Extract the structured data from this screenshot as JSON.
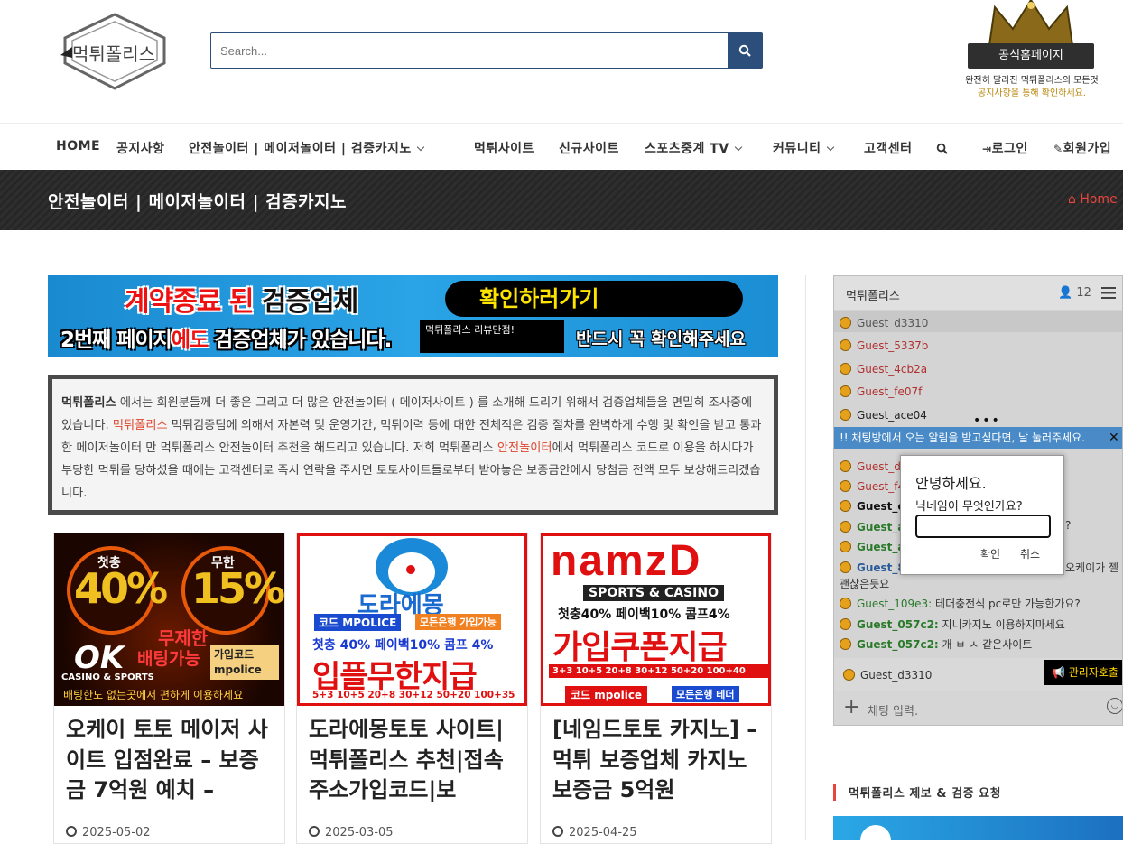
{
  "logo": {
    "text": "먹튀폴리스"
  },
  "search": {
    "placeholder": "Search..."
  },
  "crown_badge": {
    "label": "공식홈페이지",
    "line1": "완전히 달라진 먹튀폴리스의 모든것",
    "line2": "공지사항을 통해 확인하세요."
  },
  "nav": {
    "items": [
      "HOME",
      "공지사항",
      "안전놀이터 | 메이저놀이터 | 검증카지노",
      "먹튀사이트",
      "신규사이트",
      "스포츠중계 TV",
      "커뮤니티",
      "고객센터"
    ],
    "login": "로그인",
    "signup": "회원가입"
  },
  "page_title": "안전놀이터 | 메이저놀이터 | 검증카지노",
  "breadcrumb": {
    "home": "Home"
  },
  "banner": {
    "line1_red": "계약종료 된 ",
    "line1_black": "검증업체",
    "pill": "확인하러가기",
    "line2_white1": "2번째 페이지",
    "line2_red": "에도 ",
    "line2_white2": "검증업체",
    "line2_end": "가 있습니다.",
    "box": "먹튀폴리스 리뷰만점!",
    "line3": "반드시 꼭 확인해주세요"
  },
  "intro": {
    "p1_bold": "먹튀폴리스",
    "p1": " 에서는 회원분들께 더 좋은 그리고 더 많은 안전놀이터 ( 메이저사이트 ) 를 소개해 드리기 위해서 검증업체들을 면밀히 조사중에 있습니다. ",
    "p1_link": "먹튀폴리스",
    "p2": " 먹튀검증팀에 의해서 자본력 및 운영기간, 먹튀이력 등에 대한 전체적은 검증 절차를 완벽하게 수행 및 확인을 받고 통과한 메이저놀이터 만 먹튀폴리스 안전놀이터 추천을 해드리고 있습니다. 저희 먹튀폴리스 ",
    "p2_link": "안전놀이터",
    "p3": "에서 먹튀폴리스 코드로 이용을 하시다가 부당한 먹튀를 당하셨을 때에는 고객센터로 즉시 연락을 주시면 토토사이트들로부터 받아놓은 보증금안에서 당첨금 전액 모두 보상해드리겠습니다."
  },
  "cards": [
    {
      "title": "오케이 토토 메이저 사이트 입점완료 – 보증금 7억원 예치 –",
      "date": "2025-05-02",
      "thumb": {
        "a": "첫충",
        "b": "40%",
        "c": "무한",
        "d": "15%",
        "e": "무제한",
        "f": "배팅가능",
        "g": "OK",
        "h": "가입코드 mpolice",
        "i": "배팅한도 없는곳에서 편하게 이용하세요",
        "j": "CASINO & SPORTS"
      }
    },
    {
      "title": "도라에몽토토 사이트|먹튀폴리스 추천|접속주소가입코드|보",
      "date": "2025-03-05",
      "thumb": {
        "a": "도라에몽",
        "b": "코드 MPOLICE",
        "c": "모든은행 가입가능",
        "d": "첫충 40% 페이백10% 콤프 4%",
        "e": "입플무한지급",
        "f": "5+3 10+5 20+8 30+12 50+20 100+35"
      }
    },
    {
      "title": "[네임드토토 카지노] – 먹튀 보증업체 카지노 보증금 5억원",
      "date": "2025-04-25",
      "thumb": {
        "a": "namzD",
        "b": "SPORTS & CASINO",
        "c": "첫충40% 페이백10% 콤프4%",
        "d": "가입쿠폰지급",
        "e": "3+3 10+5 20+8 30+12 50+20 100+40",
        "f": "코드 mpolice",
        "g": "모든은행 테더"
      }
    }
  ],
  "chat": {
    "title": "먹튀폴리스",
    "users": "12",
    "messages": [
      {
        "name": "Guest_d3310",
        "text": "",
        "color": "#555555"
      },
      {
        "name": "Guest_5337b",
        "text": "",
        "color": "#b03030"
      },
      {
        "name": "Guest_4cb2a",
        "text": "",
        "color": "#b03030"
      },
      {
        "name": "Guest_fe07f",
        "text": "",
        "color": "#b03030"
      },
      {
        "name": "Guest_ace04",
        "text": "",
        "color": "#222222"
      }
    ],
    "notice": "!! 채팅방에서 오는 알림을 받고싶다면, 날 눌러주세요.",
    "messages2": [
      {
        "name": "Guest_d",
        "text": "",
        "color": "#b03030"
      },
      {
        "name": "Guest_f4",
        "text": "",
        "color": "#b03030"
      },
      {
        "name": "Guest_ee",
        "text": "",
        "color": "#111111"
      },
      {
        "name": "Guest_af",
        "text": "",
        "color": "#2a7a2a"
      },
      {
        "name": "Guest_af",
        "text": "",
        "color": "#2a7a2a"
      },
      {
        "name": "Guest_81",
        "text": "",
        "color": "#2a5a9a"
      }
    ],
    "wrap_right_1": "?",
    "wrap_right_2": "오케이가 젤",
    "wrap_line": "괜찮은듯요",
    "messages3": [
      {
        "name": "Guest_109e3:",
        "text": " 테더충전식 pc로만 가능한가요?",
        "color": "#2a7a2a"
      },
      {
        "name": "Guest_057c2:",
        "text": " 지니카지노 이용하지마세요",
        "color": "#2a7a2a"
      },
      {
        "name": "Guest_057c2:",
        "text": " 개 ㅂ ㅅ 같은사이트",
        "color": "#2a7a2a"
      }
    ],
    "self_name": "Guest_d3310",
    "admin_button": "관리자호출",
    "input_placeholder": "채팅 입력."
  },
  "dialog": {
    "title": "안녕하세요.",
    "question": "닉네임이 무엇인가요?",
    "ok": "확인",
    "cancel": "취소"
  },
  "sidebar": {
    "title": "먹튀폴리스 제보 & 검증 요청"
  }
}
